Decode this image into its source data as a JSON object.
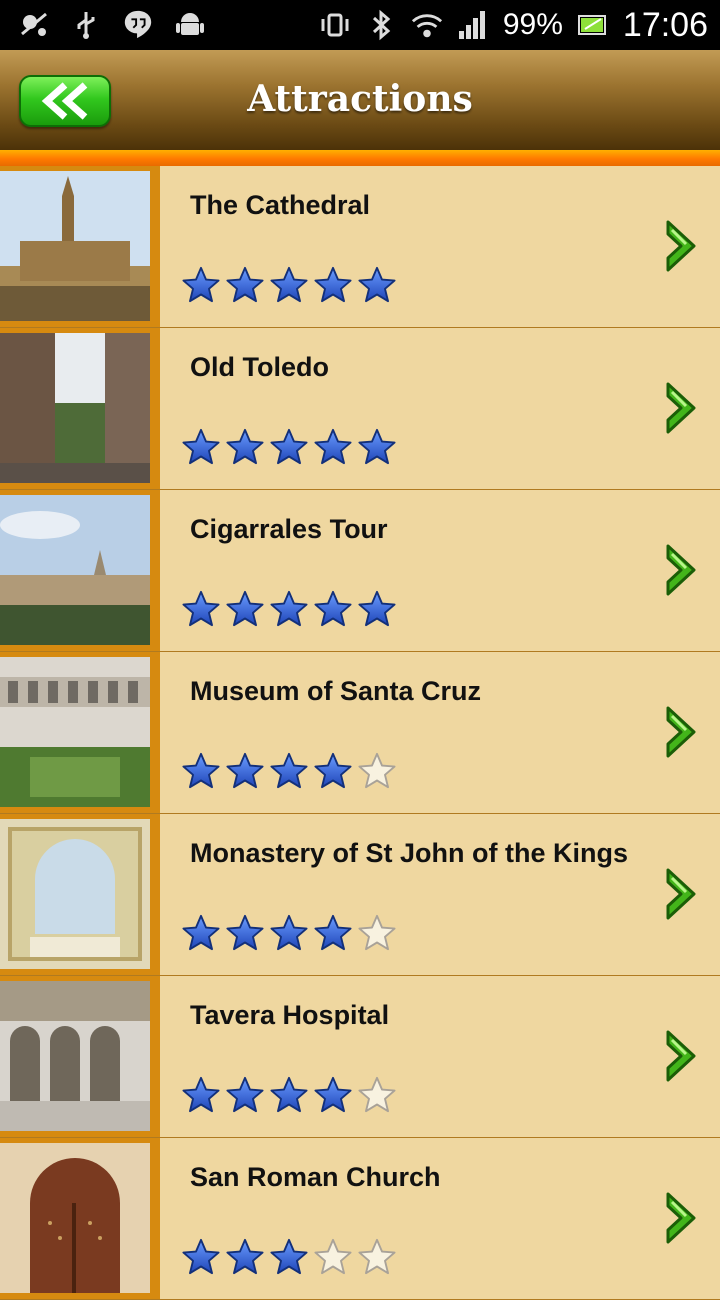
{
  "status_bar": {
    "battery": "99%",
    "time": "17:06",
    "left_icons": [
      "gps-icon",
      "usb-icon",
      "chat-icon",
      "android-icon"
    ],
    "right_icons": [
      "vibrate-icon",
      "bluetooth-icon",
      "wifi-icon",
      "signal-icon",
      "battery-icon"
    ]
  },
  "header": {
    "title": "Attractions",
    "back_icon": "double-chevron-left-icon",
    "colors": {
      "accent_stripe": "#ff8a00",
      "back_button": "#2fbf1c",
      "star_fill": "#2f5fd8"
    }
  },
  "attractions": [
    {
      "name": "The Cathedral",
      "rating": 5
    },
    {
      "name": "Old Toledo",
      "rating": 5
    },
    {
      "name": "Cigarrales Tour",
      "rating": 5
    },
    {
      "name": "Museum of Santa Cruz",
      "rating": 4
    },
    {
      "name": "Monastery of St John of the Kings",
      "rating": 4
    },
    {
      "name": "Tavera Hospital",
      "rating": 4
    },
    {
      "name": "San Roman Church",
      "rating": 3
    }
  ],
  "rating_max": 5
}
